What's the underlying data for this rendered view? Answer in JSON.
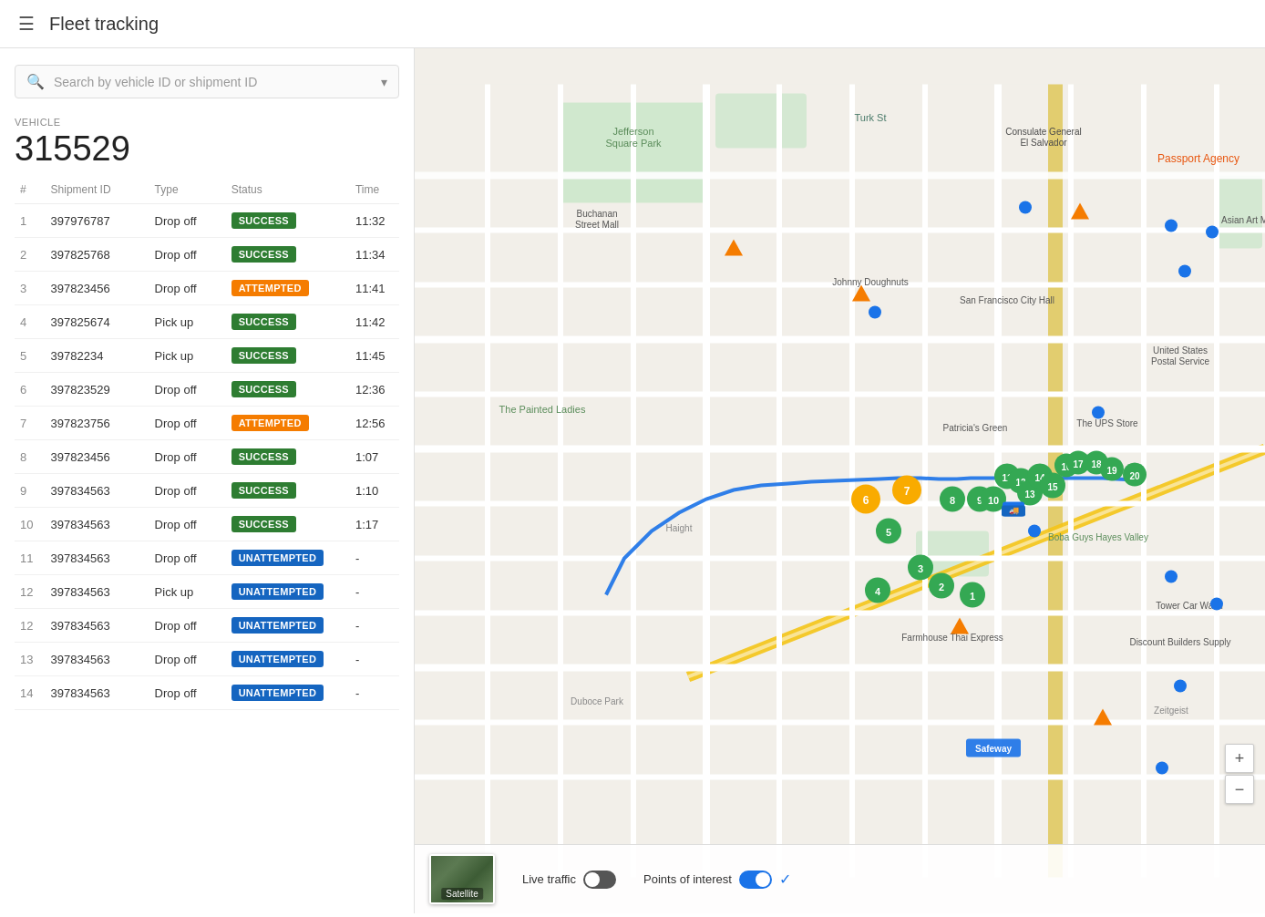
{
  "header": {
    "menu_icon": "☰",
    "title": "Fleet tracking"
  },
  "search": {
    "placeholder": "Search by vehicle ID or shipment ID",
    "dropdown_arrow": "▾"
  },
  "vehicle": {
    "label": "VEHICLE",
    "id": "315529"
  },
  "table": {
    "columns": [
      "#",
      "Shipment ID",
      "Type",
      "Status",
      "Time"
    ],
    "rows": [
      {
        "num": 1,
        "shipment": "397976787",
        "type": "Drop off",
        "status": "SUCCESS",
        "status_class": "badge-success",
        "time": "11:32"
      },
      {
        "num": 2,
        "shipment": "397825768",
        "type": "Drop off",
        "status": "SUCCESS",
        "status_class": "badge-success",
        "time": "11:34"
      },
      {
        "num": 3,
        "shipment": "397823456",
        "type": "Drop off",
        "status": "ATTEMPTED",
        "status_class": "badge-attempted",
        "time": "11:41"
      },
      {
        "num": 4,
        "shipment": "397825674",
        "type": "Pick up",
        "status": "SUCCESS",
        "status_class": "badge-success",
        "time": "11:42"
      },
      {
        "num": 5,
        "shipment": "39782234",
        "type": "Pick up",
        "status": "SUCCESS",
        "status_class": "badge-success",
        "time": "11:45"
      },
      {
        "num": 6,
        "shipment": "397823529",
        "type": "Drop off",
        "status": "SUCCESS",
        "status_class": "badge-success",
        "time": "12:36"
      },
      {
        "num": 7,
        "shipment": "397823756",
        "type": "Drop off",
        "status": "ATTEMPTED",
        "status_class": "badge-attempted",
        "time": "12:56"
      },
      {
        "num": 8,
        "shipment": "397823456",
        "type": "Drop off",
        "status": "SUCCESS",
        "status_class": "badge-success",
        "time": "1:07"
      },
      {
        "num": 9,
        "shipment": "397834563",
        "type": "Drop off",
        "status": "SUCCESS",
        "status_class": "badge-success",
        "time": "1:10"
      },
      {
        "num": 10,
        "shipment": "397834563",
        "type": "Drop off",
        "status": "SUCCESS",
        "status_class": "badge-success",
        "time": "1:17"
      },
      {
        "num": 11,
        "shipment": "397834563",
        "type": "Drop off",
        "status": "UNATTEMPTED",
        "status_class": "badge-unattempted",
        "time": "-"
      },
      {
        "num": 12,
        "shipment": "397834563",
        "type": "Pick up",
        "status": "UNATTEMPTED",
        "status_class": "badge-unattempted",
        "time": "-"
      },
      {
        "num": 12,
        "shipment": "397834563",
        "type": "Drop off",
        "status": "UNATTEMPTED",
        "status_class": "badge-unattempted",
        "time": "-"
      },
      {
        "num": 13,
        "shipment": "397834563",
        "type": "Drop off",
        "status": "UNATTEMPTED",
        "status_class": "badge-unattempted",
        "time": "-"
      },
      {
        "num": 14,
        "shipment": "397834563",
        "type": "Drop off",
        "status": "UNATTEMPTED",
        "status_class": "badge-unattempted",
        "time": "-"
      }
    ]
  },
  "map": {
    "satellite_label": "Satellite",
    "live_traffic_label": "Live traffic",
    "poi_label": "Points of interest",
    "zoom_in": "+",
    "zoom_out": "−"
  }
}
